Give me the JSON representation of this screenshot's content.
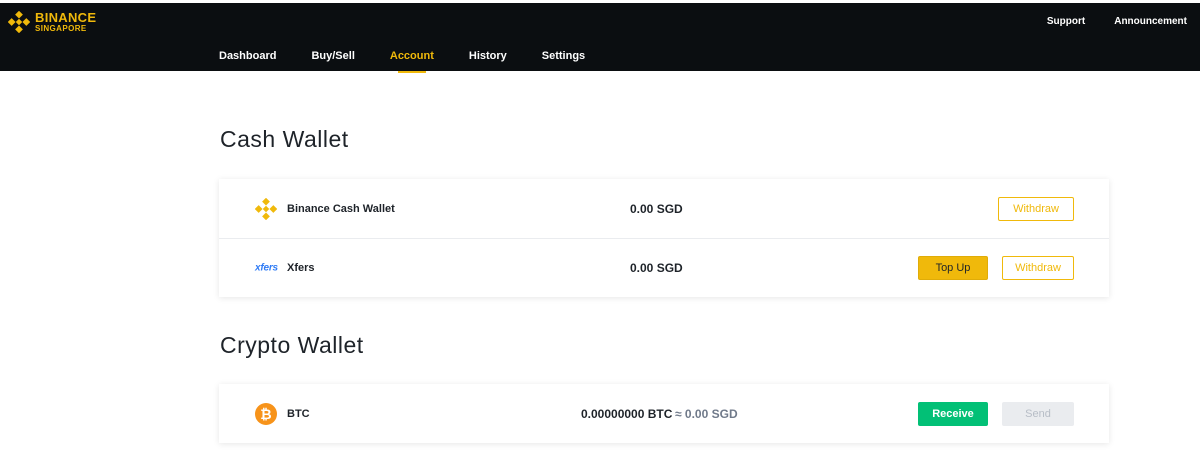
{
  "brand": {
    "line1": "BINANCE",
    "line2": "SINGAPORE",
    "accent_color": "#f0b90b",
    "header_bg": "#0b0e11"
  },
  "top_links": {
    "support": "Support",
    "announcement": "Announcement"
  },
  "nav": {
    "items": [
      {
        "label": "Dashboard"
      },
      {
        "label": "Buy/Sell"
      },
      {
        "label": "Account",
        "active": true
      },
      {
        "label": "History"
      },
      {
        "label": "Settings"
      }
    ]
  },
  "cash_wallet": {
    "title": "Cash Wallet",
    "rows": [
      {
        "icon": "binance-icon",
        "name": "Binance Cash Wallet",
        "amount": "0.00 SGD",
        "withdraw_label": "Withdraw"
      },
      {
        "icon": "xfers-icon",
        "icon_text": "xfers",
        "name": "Xfers",
        "amount": "0.00 SGD",
        "topup_label": "Top Up",
        "withdraw_label": "Withdraw"
      }
    ]
  },
  "crypto_wallet": {
    "title": "Crypto Wallet",
    "rows": [
      {
        "icon": "bitcoin-icon",
        "icon_text": "₿",
        "name": "BTC",
        "amount": "0.00000000 BTC",
        "approx": "≈ 0.00 SGD",
        "receive_label": "Receive",
        "send_label": "Send"
      }
    ]
  },
  "colors": {
    "receive": "#02c076",
    "disabled": "#eaecef",
    "bitcoin": "#f7931a",
    "xfers": "#2f7bf5"
  }
}
